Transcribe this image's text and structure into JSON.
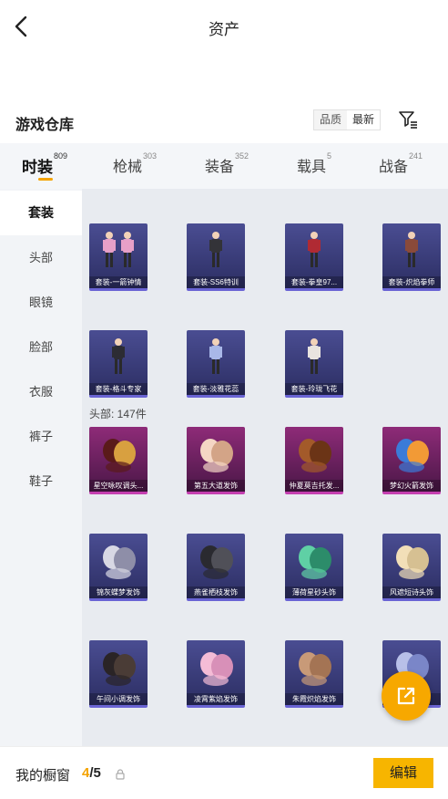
{
  "header": {
    "title": "资产",
    "back_icon": "chevron-left-icon"
  },
  "section": {
    "title": "游戏仓库",
    "sort_options": [
      "品质",
      "最新"
    ],
    "sort_active": "最新",
    "filter_icon": "filter-icon"
  },
  "tabs": [
    {
      "label": "时装",
      "count": "809",
      "active": true
    },
    {
      "label": "枪械",
      "count": "303",
      "active": false
    },
    {
      "label": "装备",
      "count": "352",
      "active": false
    },
    {
      "label": "载具",
      "count": "5",
      "active": false
    },
    {
      "label": "战备",
      "count": "241",
      "active": false
    }
  ],
  "sidebar": [
    {
      "label": "套装",
      "active": true
    },
    {
      "label": "头部",
      "active": false
    },
    {
      "label": "眼镜",
      "active": false
    },
    {
      "label": "脸部",
      "active": false
    },
    {
      "label": "衣服",
      "active": false
    },
    {
      "label": "裤子",
      "active": false
    },
    {
      "label": "鞋子",
      "active": false
    }
  ],
  "suits": [
    {
      "name": "套装-一箭钟情",
      "rarity": "blue"
    },
    {
      "name": "套装-SS6特训",
      "rarity": "blue"
    },
    {
      "name": "套装-拳皇97...",
      "rarity": "blue"
    },
    {
      "name": "套装-炽焰拳师",
      "rarity": "blue"
    },
    {
      "name": "套装-格斗专家",
      "rarity": "blue"
    },
    {
      "name": "套装-淡雅花蕊",
      "rarity": "blue"
    },
    {
      "name": "套装-玲珑飞花",
      "rarity": "blue"
    }
  ],
  "head_group_label": "头部: 147件",
  "heads": [
    {
      "name": "星空咏叹调头...",
      "rarity": "purple"
    },
    {
      "name": "第五大道发饰",
      "rarity": "purple"
    },
    {
      "name": "仲夏莫吉托发...",
      "rarity": "purple"
    },
    {
      "name": "梦幻火箭发饰",
      "rarity": "purple"
    },
    {
      "name": "锦灰蝶梦发饰",
      "rarity": "blue"
    },
    {
      "name": "燕雀栖枝发饰",
      "rarity": "blue"
    },
    {
      "name": "薄荷星砂头饰",
      "rarity": "blue"
    },
    {
      "name": "风遮短诗头饰",
      "rarity": "blue"
    },
    {
      "name": "午间小调发饰",
      "rarity": "blue"
    },
    {
      "name": "凌霄紫焰发饰",
      "rarity": "blue"
    },
    {
      "name": "朱霞炽焰发饰",
      "rarity": "blue"
    },
    {
      "name": "...头饰",
      "rarity": "blue"
    }
  ],
  "fab_icon": "external-link-icon",
  "showcase": {
    "label": "我的橱窗",
    "current": "4",
    "separator": "/",
    "total": "5",
    "lock_icon": "lock-icon",
    "edit_label": "编辑"
  },
  "colors": {
    "accent": "#f7b500",
    "blue_card": "#3a3d7c",
    "purple_card": "#7a2466"
  }
}
